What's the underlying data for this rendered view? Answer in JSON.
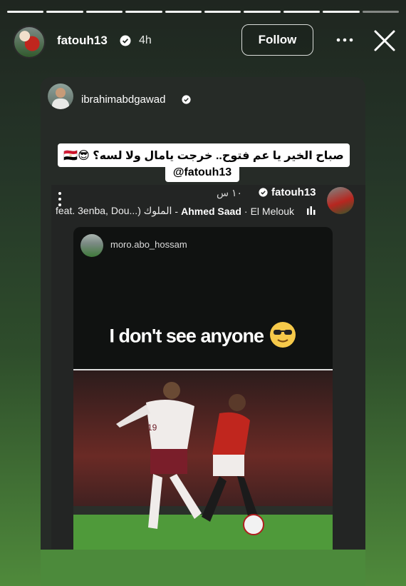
{
  "story": {
    "progress_segments": 10,
    "username": "fatouh13",
    "time": "4h",
    "follow_label": "Follow"
  },
  "reply_card": {
    "username": "ibrahimabdgawad",
    "caption": "صباح الخير يا عم فتوح.. خرجت يامال ولا لسه؟ 😎🇪🇬",
    "mention": "@fatouh13"
  },
  "shared_post": {
    "username": "fatouh13",
    "time": "١٠ س",
    "music_artist": "Ahmed Saad",
    "music_song": "El Melouk",
    "music_feat": "feat. 3enba, Dou...) الملوك",
    "inner": {
      "username": "moro.abo_hossam",
      "text": "I don't see anyone",
      "emoji": "😎",
      "jersey_number": "19"
    }
  },
  "colors": {
    "bg_top": "#1f2620",
    "bg_bottom": "#4f8a3b",
    "card": "#262b27",
    "egypt_red": "#c0261e"
  }
}
